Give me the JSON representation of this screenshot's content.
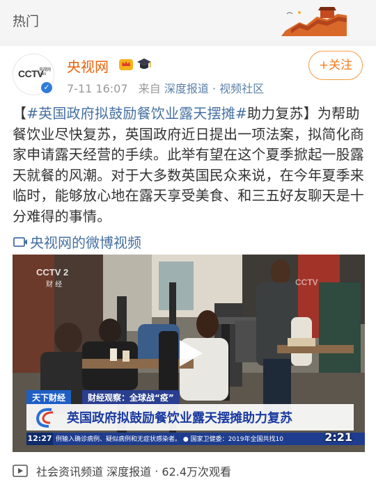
{
  "topbar": {
    "title": "热门"
  },
  "post": {
    "author": "央视网",
    "avatar_logo": "CCTV",
    "avatar_logo_sub": "央视网 com",
    "date": "7-11 16:07",
    "from_label": "来自",
    "source": "深度报道 · 视频社区",
    "follow_label": "+关注",
    "text_open": "【",
    "hashtag": "#英国政府拟鼓励餐饮业露天摆摊#",
    "text_close": "助力复苏】",
    "body": "为帮助餐饮业尽快复苏，英国政府近日提出一项法案，拟简化商家申请露天经营的手续。此举有望在这个夏季掀起一股露天就餐的风潮。对于大多数英国民众来说，在今年夏季来临时，能够放心地在露天享受美食、和三五好友聊天是十分难得的事情。",
    "video_link": "央视网的微博视频"
  },
  "video": {
    "tag_channel": "天下财经",
    "tag_segment": "财经观察：全球战“疫”",
    "headline": "英国政府拟鼓励餐饮业露天摆摊助力复苏",
    "clock": "12:27",
    "ticker": "例输入确诊病例、疑似病例和无症状感染者。 ● 国家卫健委：2019年全国共找10",
    "duration": "2:21",
    "watermark": "CCTV 2 财经"
  },
  "footer": {
    "channel": "社会资讯频道",
    "source": "深度报道",
    "views": "62.4万次观看"
  },
  "colors": {
    "accent": "#e8640c",
    "link": "#4570a1",
    "verified": "#2f7cd9"
  },
  "icons": [
    "vip-crown-icon",
    "graduation-cap-icon",
    "verified-badge-icon",
    "video-link-icon",
    "play-icon",
    "video-channel-icon"
  ]
}
